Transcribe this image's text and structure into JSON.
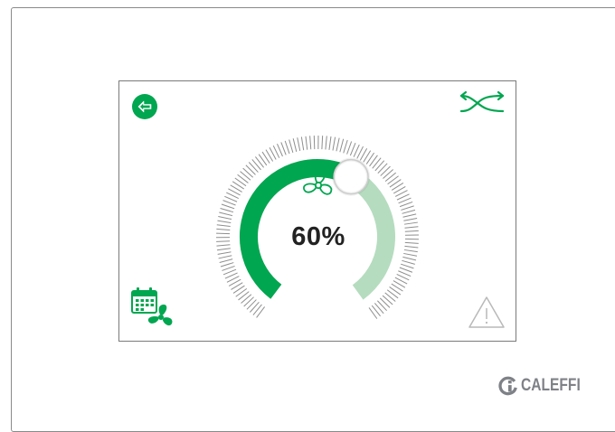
{
  "screen": {
    "fan_speed": {
      "value": 60,
      "label": "60%"
    },
    "icons": {
      "back": "back-arrow-icon",
      "mode": "crossover-arrows-icon",
      "fan": "fan-icon",
      "schedule": "calendar-fan-icon",
      "alarm": "warning-triangle-icon"
    }
  },
  "brand": {
    "name": "CALEFFI"
  },
  "colors": {
    "accent": "#00a650",
    "track": "#b5dcbf",
    "ticks": "#8e8e8e",
    "warning": "#b9b9b9",
    "brand_gray": "#7e8186"
  }
}
